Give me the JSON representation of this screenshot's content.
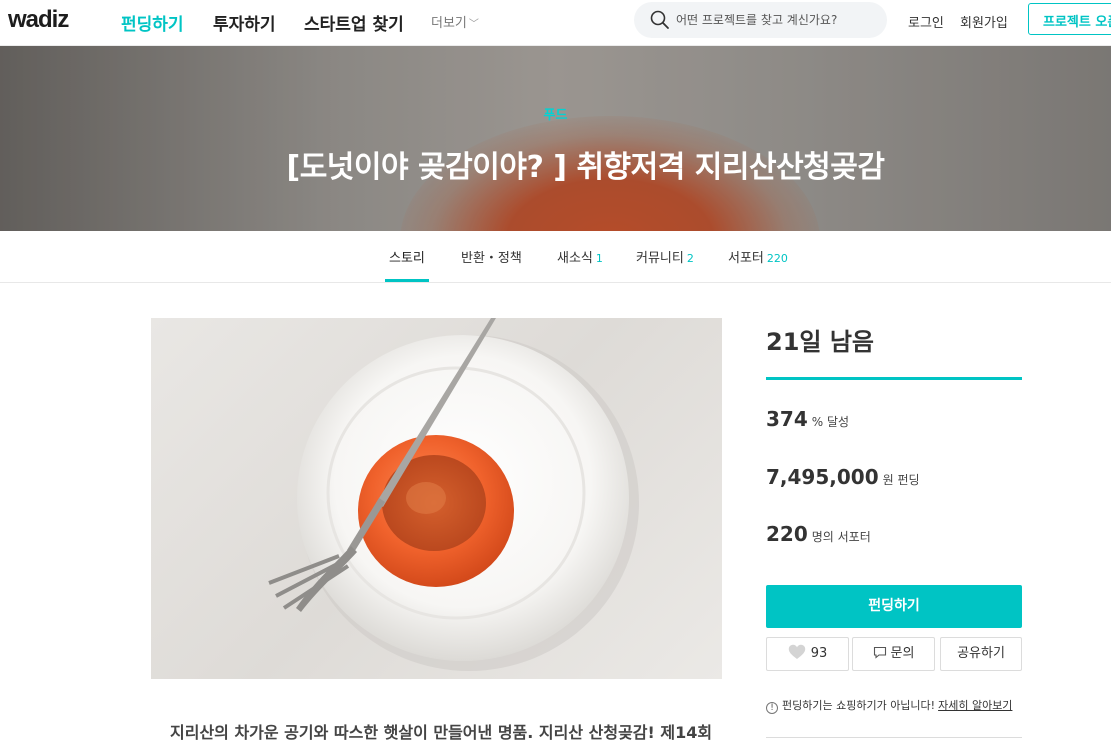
{
  "header": {
    "logo": "wadiz",
    "nav": [
      {
        "label": "펀딩하기",
        "active": true
      },
      {
        "label": "투자하기",
        "active": false
      },
      {
        "label": "스타트업 찾기",
        "active": false
      }
    ],
    "more_label": "더보기",
    "search_placeholder": "어떤 프로젝트를 찾고 계신가요?",
    "login_label": "로그인",
    "signup_label": "회원가입",
    "open_project_label": "프로젝트 오픈"
  },
  "hero": {
    "category": "푸드",
    "title": "[도넛이야 곶감이야? ] 취향저격 지리산산청곶감"
  },
  "tabs": [
    {
      "label": "스토리",
      "count": "",
      "active": true
    },
    {
      "label": "반환・정책",
      "count": "",
      "active": false
    },
    {
      "label": "새소식",
      "count": "1",
      "active": false
    },
    {
      "label": "커뮤니티",
      "count": "2",
      "active": false
    },
    {
      "label": "서포터",
      "count": "220",
      "active": false
    }
  ],
  "story": {
    "intro": "지리산의 차가운 공기와 따스한 햇살이 만들어낸 명품. 지리산 산청곶감! 제14회"
  },
  "side": {
    "days_left": "21일 남음",
    "progress_percent": 374,
    "achieved_num": "374",
    "achieved_unit": "% 달성",
    "amount_num": "7,495,000",
    "amount_unit": "원 펀딩",
    "supporters_num": "220",
    "supporters_unit": "명의 서포터",
    "fund_button": "펀딩하기",
    "like_count": "93",
    "inquiry_label": "문의",
    "share_label": "공유하기",
    "notice_text": "펀딩하기는 쇼핑하기가 아닙니다!",
    "notice_link": "자세히 알아보기"
  },
  "colors": {
    "accent": "#00c4c4",
    "text": "#333333"
  }
}
